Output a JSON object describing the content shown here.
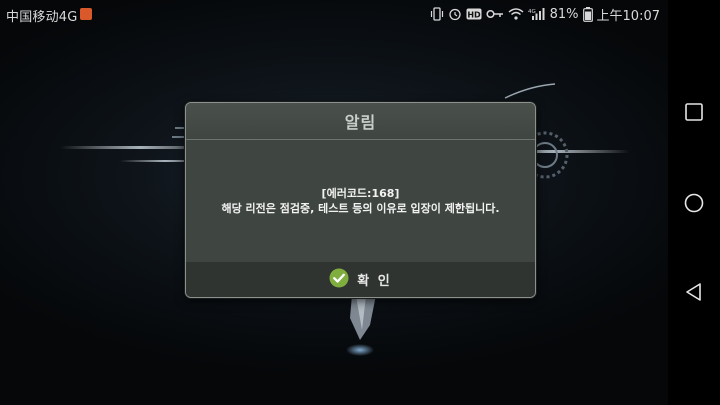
{
  "status_bar": {
    "carrier": "中国移动4G",
    "battery": "81%",
    "time": "上午10:07",
    "icons": [
      "notification-icon",
      "vibrate-icon",
      "alarm-icon",
      "hd-icon",
      "key-icon",
      "wifi-icon",
      "signal-icon"
    ]
  },
  "dialog": {
    "title": "알림",
    "error_code": "[에러코드:168]",
    "message": "해당 리전은 점검중, 테스트 등의 이유로 입장이 제한됩니다.",
    "confirm_label": "확 인"
  },
  "nav_bar": {
    "buttons": [
      "recents",
      "home",
      "back"
    ]
  },
  "colors": {
    "dialog_bg": "#3f4541",
    "dialog_footer": "#2f3431",
    "confirm_check": "#7fae3f"
  }
}
